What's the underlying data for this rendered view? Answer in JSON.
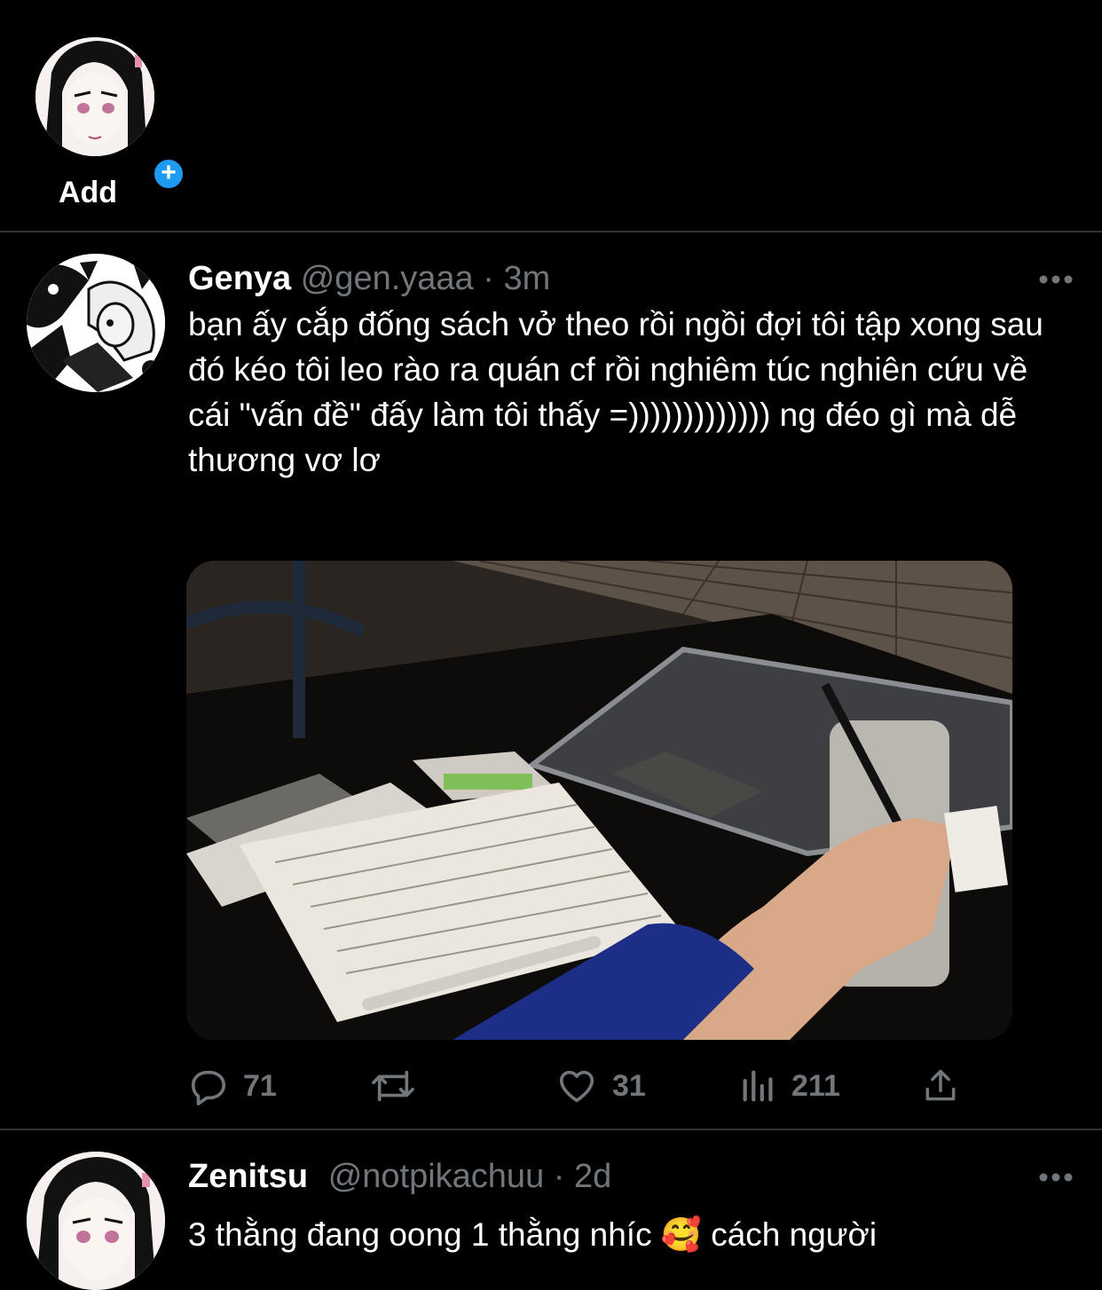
{
  "stories": {
    "add_label": "Add",
    "add_badge": "+"
  },
  "tweets": [
    {
      "display_name": "Genya",
      "handle": "@gen.yaaa",
      "separator": "·",
      "time": "3m",
      "text": "bạn ấy cắp đống sách vở theo rồi ngồi đợi tôi tập xong sau đó kéo tôi leo rào ra quán cf rồi nghiêm túc nghiên cứu về cái \"vấn đề\" đấy làm tôi thấy =))))))))))))) ng đéo gì mà dễ thương vơ lơ",
      "replies": "71",
      "retweets": "",
      "likes": "31",
      "views": "211"
    },
    {
      "display_name": "Zenitsu",
      "handle": "@notpikachuu",
      "separator": "·",
      "time": "2d",
      "text": "3 thằng đang oong 1 thằng nhíc 🥰  cách người"
    }
  ],
  "icons": {
    "more": "more-horizontal-icon",
    "reply": "reply-icon",
    "retweet": "retweet-icon",
    "like": "heart-icon",
    "views": "views-icon",
    "share": "share-icon"
  },
  "colors": {
    "background": "#000000",
    "text": "#ffffff",
    "secondary": "#71767b",
    "divider": "#2f3336",
    "accent": "#1d9bf0"
  }
}
